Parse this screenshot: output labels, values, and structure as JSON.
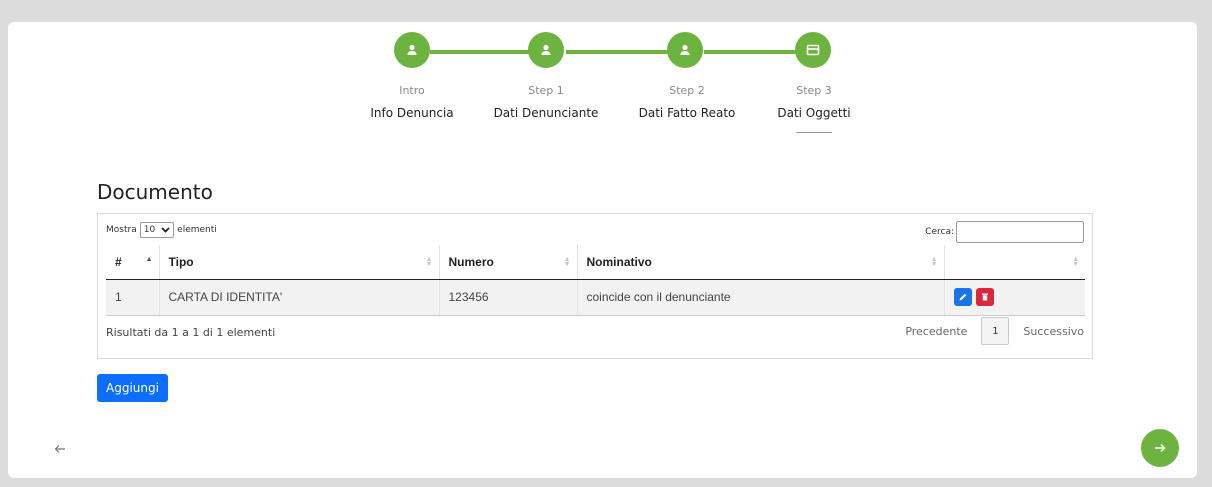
{
  "colors": {
    "accent": "#6cb33f",
    "primary": "#0d6efd",
    "edit": "#1a73e8",
    "delete": "#d9283b"
  },
  "stepper": {
    "steps": [
      {
        "kicker": "Intro",
        "label": "Info Denuncia",
        "icon": "user-icon"
      },
      {
        "kicker": "Step 1",
        "label": "Dati Denunciante",
        "icon": "user-icon"
      },
      {
        "kicker": "Step 2",
        "label": "Dati Fatto Reato",
        "icon": "user-icon"
      },
      {
        "kicker": "Step 3",
        "label": "Dati Oggetti",
        "icon": "card-icon"
      }
    ],
    "active_index": 3
  },
  "section": {
    "title": "Documento"
  },
  "table": {
    "length": {
      "prefix": "Mostra",
      "value": "10",
      "suffix": "elementi"
    },
    "search_label": "Cerca:",
    "columns": [
      "#",
      "Tipo",
      "Numero",
      "Nominativo",
      ""
    ],
    "rows": [
      {
        "num": "1",
        "tipo": "CARTA DI IDENTITA'",
        "numero": "123456",
        "nominativo": "coincide con il denunciante"
      }
    ],
    "info": "Risultati da 1 a 1 di 1 elementi",
    "pager": {
      "prev": "Precedente",
      "page": "1",
      "next": "Successivo"
    }
  },
  "actions": {
    "add_label": "Aggiungi"
  }
}
